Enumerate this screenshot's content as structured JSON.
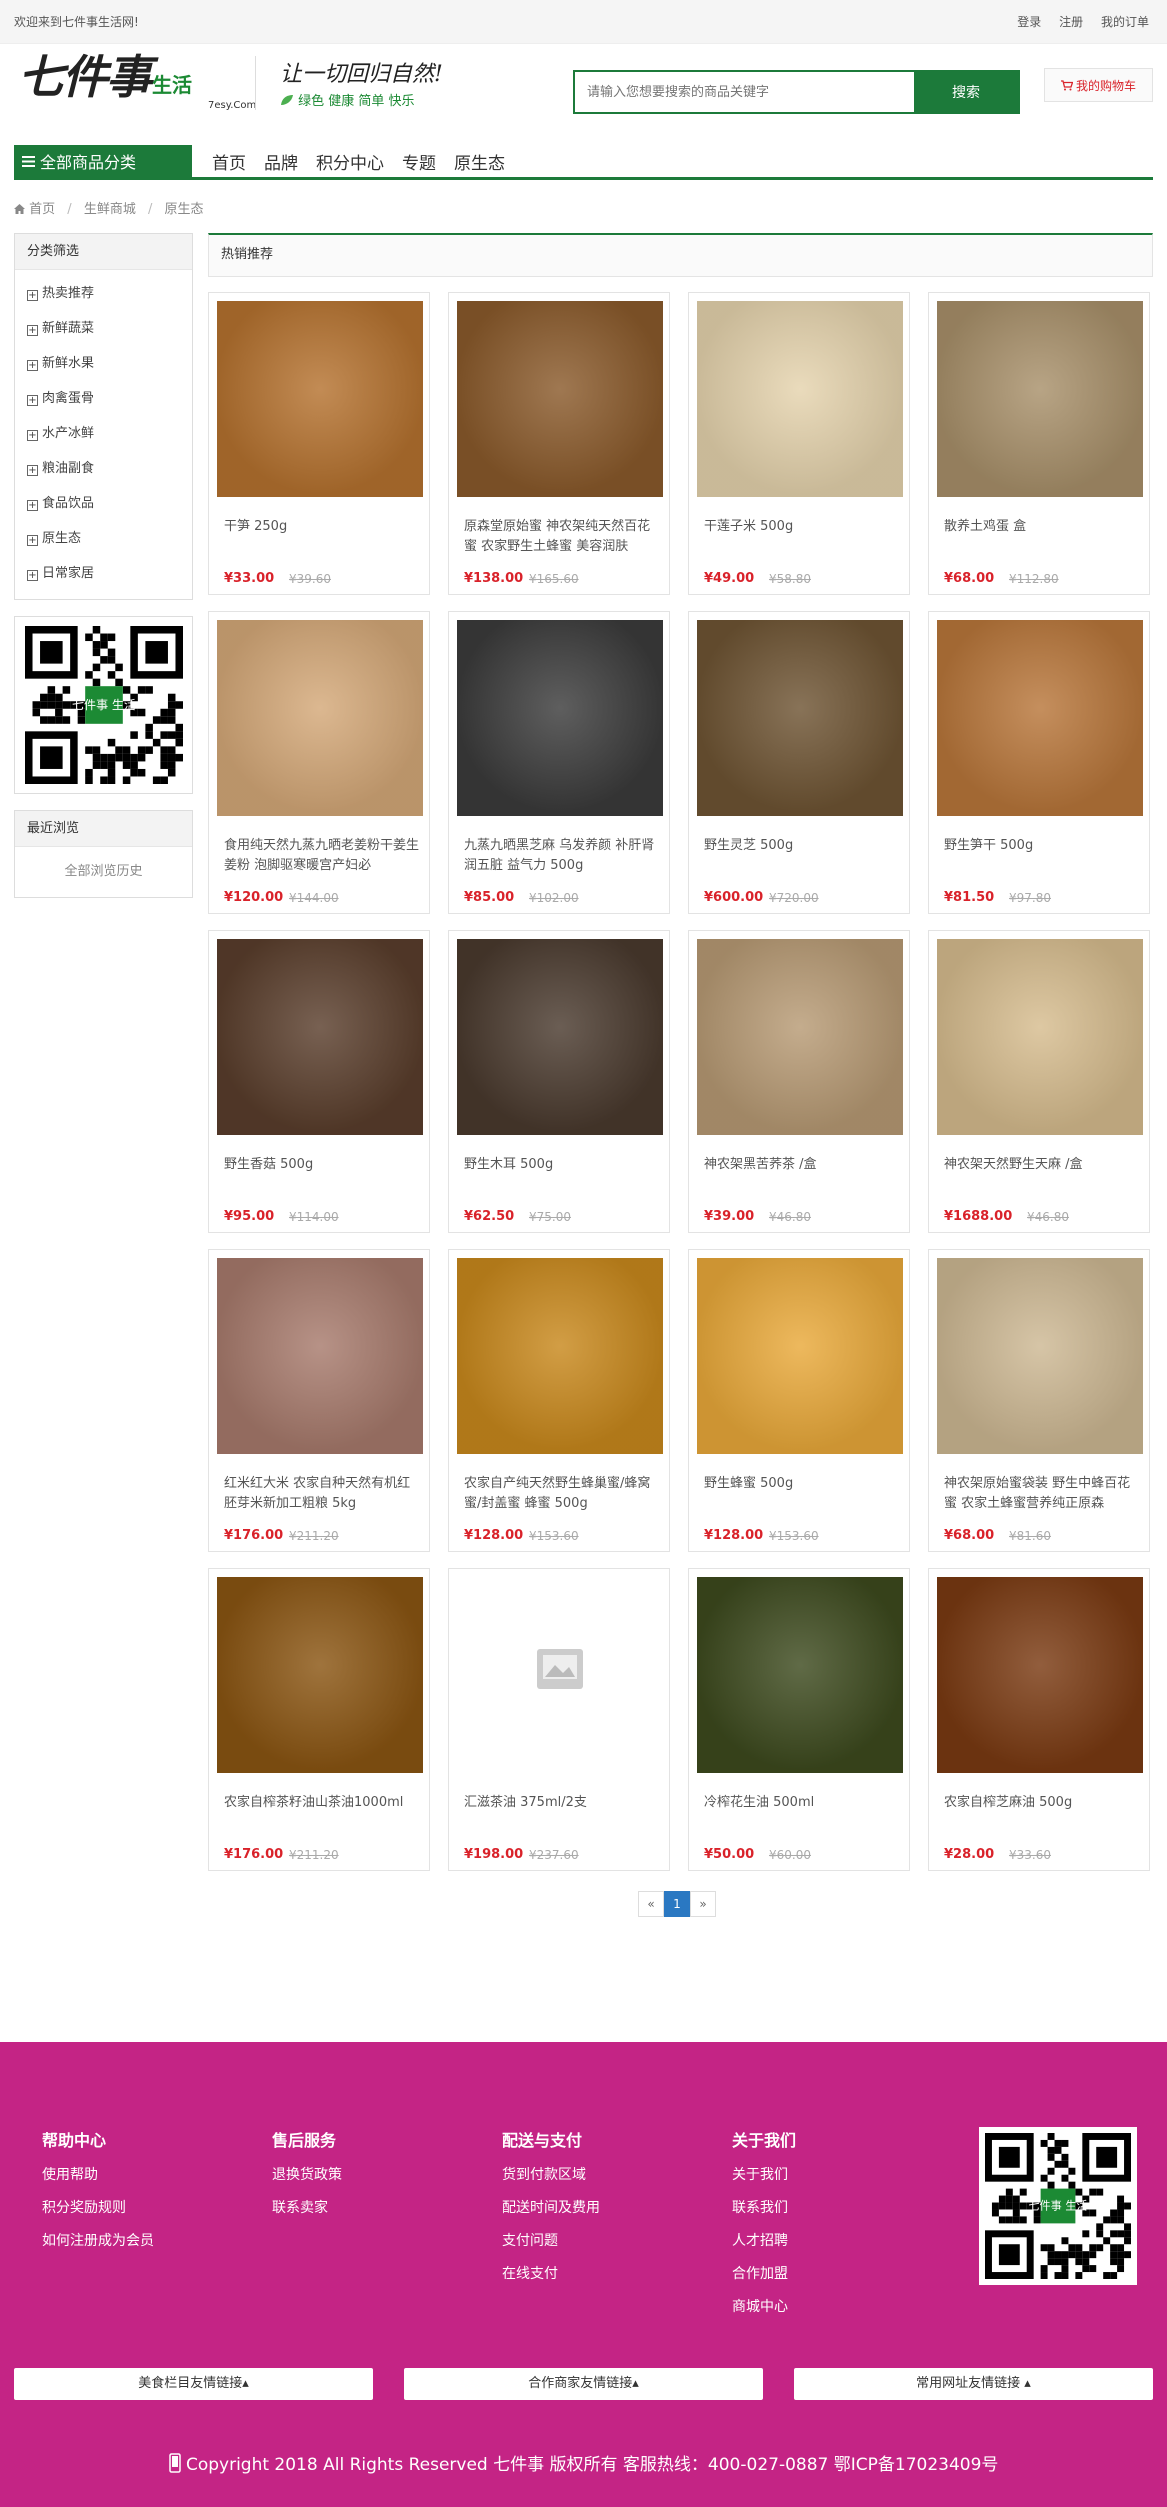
{
  "topbar": {
    "welcome": "欢迎来到七件事生活网!",
    "login": "登录",
    "register": "注册",
    "my_orders": "我的订单"
  },
  "header": {
    "logo_main": "七件事",
    "logo_small": "生活",
    "logo_sub": "7esy.Com",
    "slogan": "让一切回归自然!",
    "slogan_tags": "绿色 健康 简单 快乐",
    "search_placeholder": "请输入您想要搜索的商品关键字",
    "search_button": "搜索",
    "cart": "我的购物车"
  },
  "nav": {
    "all_categories": "全部商品分类",
    "items": [
      "首页",
      "品牌",
      "积分中心",
      "专题",
      "原生态"
    ]
  },
  "breadcrumb": [
    "首页",
    "生鲜商城",
    "原生态"
  ],
  "sidebar": {
    "filter_title": "分类筛选",
    "categories": [
      "热卖推荐",
      "新鲜蔬菜",
      "新鲜水果",
      "肉禽蛋骨",
      "水产冰鲜",
      "粮油副食",
      "食品饮品",
      "原生态",
      "日常家居"
    ],
    "recent_title": "最近浏览",
    "recent_all": "全部浏览历史",
    "qr_label": "七件事 生活"
  },
  "section_title": "热销推荐",
  "products": [
    {
      "name": "干笋 250g",
      "price": "¥33.00",
      "old": "¥39.60",
      "color": "#b5722f"
    },
    {
      "name": "原森堂原始蜜 神农架纯天然百花蜜 农家野生土蜂蜜 美容润肤",
      "price": "¥138.00",
      "old": "¥165.60",
      "color": "#8a5a2b"
    },
    {
      "name": "干莲子米 500g",
      "price": "¥49.00",
      "old": "¥58.80",
      "color": "#e5d3ad"
    },
    {
      "name": "散养土鸡蛋 盒",
      "price": "¥68.00",
      "old": "¥112.80",
      "color": "#a8906a"
    },
    {
      "name": "食用纯天然九蒸九晒老姜粉干姜生姜粉 泡脚驱寒暖宫产妇必",
      "price": "¥120.00",
      "old": "¥144.00",
      "color": "#d4a878"
    },
    {
      "name": "九蒸九晒黑芝麻 乌发养颜 补肝肾 润五脏 益气力 500g",
      "price": "¥85.00",
      "old": "¥102.00",
      "color": "#3b3b3b"
    },
    {
      "name": "野生灵芝 500g",
      "price": "¥600.00",
      "old": "¥720.00",
      "color": "#6e5433"
    },
    {
      "name": "野生笋干 500g",
      "price": "¥81.50",
      "old": "¥97.80",
      "color": "#b8763a"
    },
    {
      "name": "野生香菇 500g",
      "price": "¥95.00",
      "old": "¥114.00",
      "color": "#5a3e2c"
    },
    {
      "name": "野生木耳 500g",
      "price": "¥62.50",
      "old": "¥75.00",
      "color": "#4a3a2e"
    },
    {
      "name": "神农架黑苦荞茶 /盒",
      "price": "¥39.00",
      "old": "¥46.80",
      "color": "#b79a74"
    },
    {
      "name": "神农架天然野生天麻 /盒",
      "price": "¥1688.00",
      "old": "¥46.80",
      "color": "#d6bc8e"
    },
    {
      "name": "红米红大米 农家自种天然有机红胚芽米新加工粗粮 5kg",
      "price": "¥176.00",
      "old": "¥211.20",
      "color": "#a77a6c"
    },
    {
      "name": "农家自产纯天然野生蜂巢蜜/蜂窝蜜/封盖蜜 蜂蜜 500g",
      "price": "¥128.00",
      "old": "¥153.60",
      "color": "#c8881c"
    },
    {
      "name": "野生蜂蜜 500g",
      "price": "¥128.00",
      "old": "¥153.60",
      "color": "#e9a93a"
    },
    {
      "name": "神农架原始蜜袋装 野生中蜂百花蜜 农家土蜂蜜营养纯正原森",
      "price": "¥68.00",
      "old": "¥81.60",
      "color": "#cdb893"
    },
    {
      "name": "农家自榨茶籽油山茶油1000ml",
      "price": "¥176.00",
      "old": "¥211.20",
      "color": "#8a5512"
    },
    {
      "name": "汇滋茶油 375ml/2支",
      "price": "¥198.00",
      "old": "¥237.60",
      "color": "#ffffff"
    },
    {
      "name": "冷榨花生油 500ml",
      "price": "¥50.00",
      "old": "¥60.00",
      "color": "#3d4a1e"
    },
    {
      "name": "农家自榨芝麻油 500g",
      "price": "¥28.00",
      "old": "¥33.60",
      "color": "#7a3a12"
    }
  ],
  "pager": {
    "prev": "«",
    "current": "1",
    "next": "»"
  },
  "footer": {
    "columns": [
      {
        "title": "帮助中心",
        "items": [
          "使用帮助",
          "积分奖励规则",
          "如何注册成为会员"
        ]
      },
      {
        "title": "售后服务",
        "items": [
          "退换货政策",
          "联系卖家"
        ]
      },
      {
        "title": "配送与支付",
        "items": [
          "货到付款区域",
          "配送时间及费用",
          "支付问题",
          "在线支付"
        ]
      },
      {
        "title": "关于我们",
        "items": [
          "关于我们",
          "联系我们",
          "人才招聘",
          "合作加盟",
          "商城中心"
        ]
      }
    ],
    "link_buttons": [
      "美食栏目友情链接▴",
      "合作商家友情链接▴",
      "常用网址友情链接 ▴"
    ],
    "copyright": "Copyright 2018 All Rights Reserved 七件事 版权所有 客服热线：400-027-0887 鄂ICP备17023409号"
  },
  "colors": {
    "brand_green": "#1c7a3a",
    "price_red": "#d9222a",
    "footer_magenta": "#c42485",
    "pager_blue": "#2a78c2"
  }
}
